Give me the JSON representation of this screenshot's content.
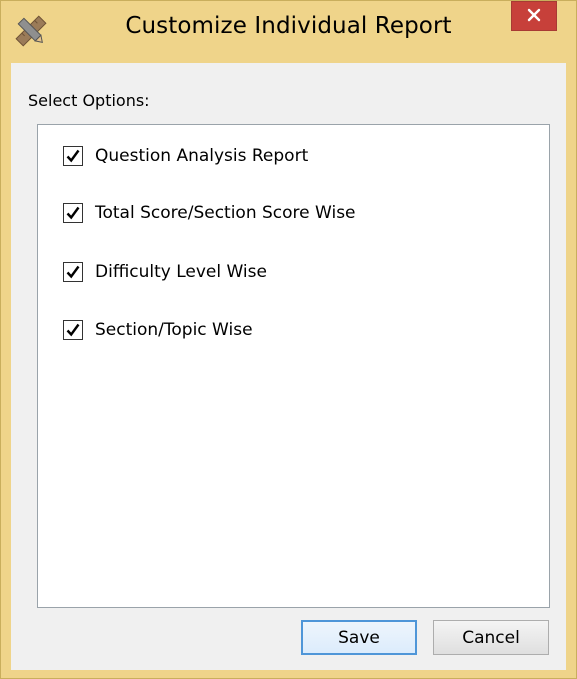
{
  "window": {
    "title": "Customize Individual Report",
    "icon": "pencil-ruler-icon",
    "close_icon": "close-icon",
    "accent_color": "#efd48a",
    "close_color": "#c7403a"
  },
  "options_section": {
    "label": "Select Options:",
    "items": [
      {
        "label": "Question Analysis Report",
        "checked": true
      },
      {
        "label": "Total Score/Section Score Wise",
        "checked": true
      },
      {
        "label": "Difficulty Level Wise",
        "checked": true
      },
      {
        "label": "Section/Topic Wise",
        "checked": true
      }
    ]
  },
  "buttons": {
    "save_label": "Save",
    "cancel_label": "Cancel",
    "focus_color": "#4f96d8"
  }
}
